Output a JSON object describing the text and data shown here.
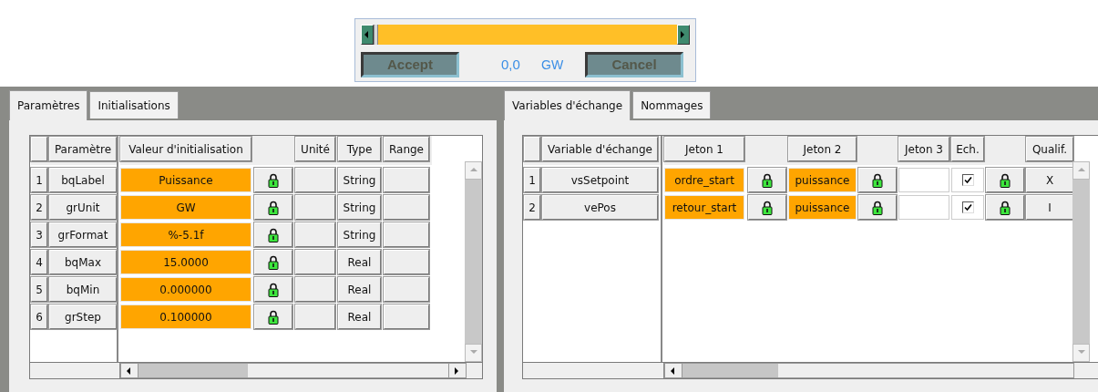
{
  "dialog": {
    "slider": {
      "level": 0
    },
    "value": "0,0",
    "unit": "GW",
    "buttons": [
      {
        "label": "Accept",
        "disabled": true
      },
      {
        "label": "Cancel",
        "disabled": true
      }
    ]
  },
  "left_panel": {
    "tabs": [
      {
        "label": "Paramètres",
        "selected": true
      },
      {
        "label": "Initialisations",
        "selected": false
      }
    ],
    "columns": {
      "name": "Paramètre",
      "value": "Valeur d'initialisation",
      "unit": "Unité",
      "type": "Type",
      "range": "Range"
    },
    "rows": [
      {
        "index": "1",
        "name": "bqLabel",
        "value": "Puissance",
        "locked": true,
        "type": "String"
      },
      {
        "index": "2",
        "name": "grUnit",
        "value": "GW",
        "locked": true,
        "type": "String"
      },
      {
        "index": "3",
        "name": "grFormat",
        "value": "%-5.1f",
        "locked": true,
        "type": "String"
      },
      {
        "index": "4",
        "name": "bqMax",
        "value": "15.0000",
        "locked": true,
        "type": "Real"
      },
      {
        "index": "5",
        "name": "bqMin",
        "value": "0.000000",
        "locked": true,
        "type": "Real"
      },
      {
        "index": "6",
        "name": "grStep",
        "value": "0.100000",
        "locked": true,
        "type": "Real"
      }
    ]
  },
  "right_panel": {
    "tabs": [
      {
        "label": "Variables d'échange",
        "selected": true
      },
      {
        "label": "Nommages",
        "selected": false
      }
    ],
    "columns": {
      "variable": "Variable d'échange",
      "jeton_1": "Jeton 1",
      "jeton_2": "Jeton 2",
      "jeton_3": "Jeton 3",
      "ech": "Ech.",
      "qualif": "Qualif."
    },
    "rows": [
      {
        "index": "1",
        "variable": "vsSetpoint",
        "jeton_1": "ordre_start",
        "jeton_1_locked": true,
        "jeton_2": "puissance",
        "jeton_2_locked": true,
        "ech_checked": true,
        "ech_locked": true,
        "qualif": "X"
      },
      {
        "index": "2",
        "variable": "vePos",
        "jeton_1": "retour_start",
        "jeton_1_locked": true,
        "jeton_2": "puissance",
        "jeton_2_locked": true,
        "ech_checked": true,
        "ech_locked": true,
        "qualif": "I"
      }
    ]
  }
}
